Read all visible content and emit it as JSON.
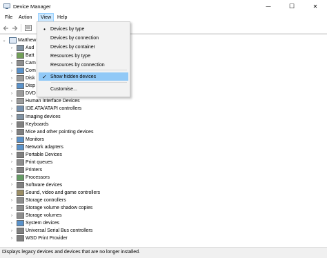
{
  "window": {
    "title": "Device Manager",
    "minimize_glyph": "—",
    "maximize_glyph": "☐",
    "close_glyph": "✕"
  },
  "menubar": {
    "items": [
      "File",
      "Action",
      "View",
      "Help"
    ],
    "active": "View"
  },
  "view_menu": {
    "items": [
      {
        "label": "Devices by type",
        "mark": "•"
      },
      {
        "label": "Devices by connection",
        "mark": ""
      },
      {
        "label": "Devices by container",
        "mark": ""
      },
      {
        "label": "Resources by type",
        "mark": ""
      },
      {
        "label": "Resources by connection",
        "mark": ""
      },
      {
        "label": "Show hidden devices",
        "mark": "✓",
        "highlighted": true
      },
      {
        "label": "Customise...",
        "mark": ""
      }
    ]
  },
  "tree": {
    "root": "Matthew",
    "partial_items": [
      "Aud",
      "Batt",
      "Cam",
      "Com",
      "Disk",
      "Disp",
      "DVD"
    ],
    "items": [
      "Human Interface Devices",
      "IDE ATA/ATAPI controllers",
      "Imaging devices",
      "Keyboards",
      "Mice and other pointing devices",
      "Monitors",
      "Network adapters",
      "Portable Devices",
      "Print queues",
      "Printers",
      "Processors",
      "Software devices",
      "Sound, video and game controllers",
      "Storage controllers",
      "Storage volume shadow copies",
      "Storage volumes",
      "System devices",
      "Universal Serial Bus controllers",
      "WSD Print Provider"
    ],
    "icon_names": [
      "audio-icon",
      "battery-icon",
      "camera-icon",
      "computer-icon",
      "disk-drive-icon",
      "display-icon",
      "dvd-drive-icon",
      "hid-icon",
      "ide-controller-icon",
      "imaging-icon",
      "keyboard-icon",
      "mouse-icon",
      "monitor-icon",
      "network-adapter-icon",
      "portable-device-icon",
      "print-queue-icon",
      "printer-icon",
      "processor-icon",
      "software-device-icon",
      "sound-icon",
      "storage-controller-icon",
      "shadow-copy-icon",
      "storage-volume-icon",
      "system-device-icon",
      "usb-controller-icon",
      "wsd-print-icon"
    ]
  },
  "status": {
    "text": "Displays legacy devices and devices that are no longer installed."
  },
  "colors": {
    "menu_active_bg": "#cce8ff",
    "menu_hover_bg": "#91c9f7",
    "dropdown_bg": "#f2f2f2",
    "statusbar_bg": "#f0f0f0",
    "check_color": "#1a1a1a"
  }
}
